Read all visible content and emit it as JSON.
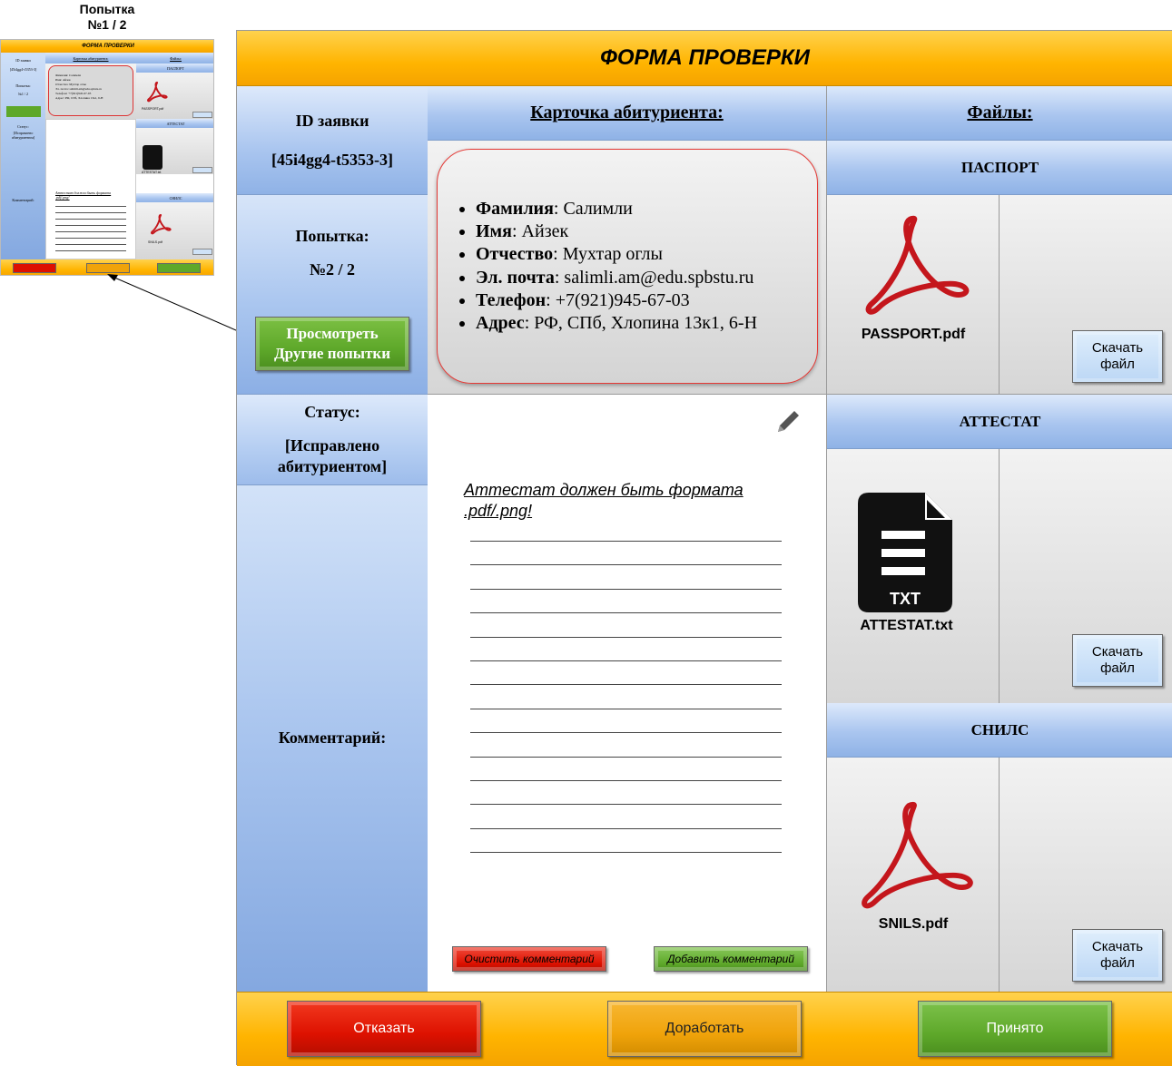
{
  "thumbnail": {
    "caption_line1": "Попытка",
    "caption_line2": "№1 / 2",
    "header": "ФОРМА ПРОВЕРКИ",
    "col_card": "Карточка абитуриента:",
    "col_files": "Файлы:",
    "id_label": "ID заявки",
    "id_value": "[45i4gg4-t5353-3]",
    "attempt_label": "Попытка:",
    "attempt_value": "№1 / 2",
    "status_label": "Статус:",
    "status_value": "[Исправлено абитуриентом]",
    "comment_label": "Комментарий:",
    "file1_name": "PASSPORT.pdf",
    "file2_name": "ATTESTAT.txt",
    "file3_name": "SNILS.pdf",
    "passport_label": "ПАСПОРТ",
    "attestat_label": "АТТЕСТАТ",
    "snils_label": "СНИЛС",
    "comment_text": "Аттестат должен быть формата .pdf/.png!",
    "card_lines": [
      "Фамилия: Салимли",
      "Имя: Айзек",
      "Отчество: Мухтар оглы",
      "Эл. почта: salimli.am@edu.spbstu.ru",
      "Телефон: +7(921)945-67-03",
      "Адрес: РФ, СПб, Хлопина 13к1, 6-Н"
    ]
  },
  "header": {
    "title": "ФОРМА ПРОВЕРКИ"
  },
  "left": {
    "id_label": "ID заявки",
    "id_value": "[45i4gg4-t5353-3]",
    "attempt_label": "Попытка:",
    "attempt_value": "№2 / 2",
    "view_button_line1": "Просмотреть",
    "view_button_line2": "Другие попытки",
    "status_label": "Статус:",
    "status_value_line1": "[Исправлено",
    "status_value_line2": "абитуриентом]",
    "comment_label": "Комментарий:"
  },
  "card": {
    "header": "Карточка абитуриента:",
    "fields": [
      {
        "label": "Фамилия",
        "value": ": Салимли"
      },
      {
        "label": "Имя",
        "value": ": Айзек"
      },
      {
        "label": "Отчество",
        "value": ": Мухтар оглы"
      },
      {
        "label": "Эл. почта",
        "value": ": salimli.am@edu.spbstu.ru"
      },
      {
        "label": "Телефон",
        "value": ": +7(921)945-67-03"
      },
      {
        "label": "Адрес",
        "value": ": РФ, СПб, Хлопина 13к1, 6-Н"
      }
    ]
  },
  "comment": {
    "text_line1": "Аттестат должен быть формата",
    "text_line2": ".pdf/.png!",
    "clear_button": "Очистить комментарий",
    "add_button": "Добавить комментарий",
    "edit_icon": "pencil-icon"
  },
  "files": {
    "header": "Файлы:",
    "download_line1": "Скачать",
    "download_line2": "файл",
    "items": [
      {
        "section": "ПАСПОРТ",
        "filename": "PASSPORT.pdf",
        "icon": "pdf-icon"
      },
      {
        "section": "АТТЕСТАТ",
        "filename": "ATTESTAT.txt",
        "icon": "txt-file-icon",
        "badge": "TXT"
      },
      {
        "section": "СНИЛС",
        "filename": "SNILS.pdf",
        "icon": "pdf-icon"
      }
    ]
  },
  "footer": {
    "reject": "Отказать",
    "rework": "Доработать",
    "accept": "Принято"
  },
  "colors": {
    "orange": "#ffb400",
    "blue": "#a9c5ef",
    "reject": "#dd1100",
    "rework": "#f0a30a",
    "accept": "#5ea82a",
    "pdf_red": "#c4161c"
  }
}
